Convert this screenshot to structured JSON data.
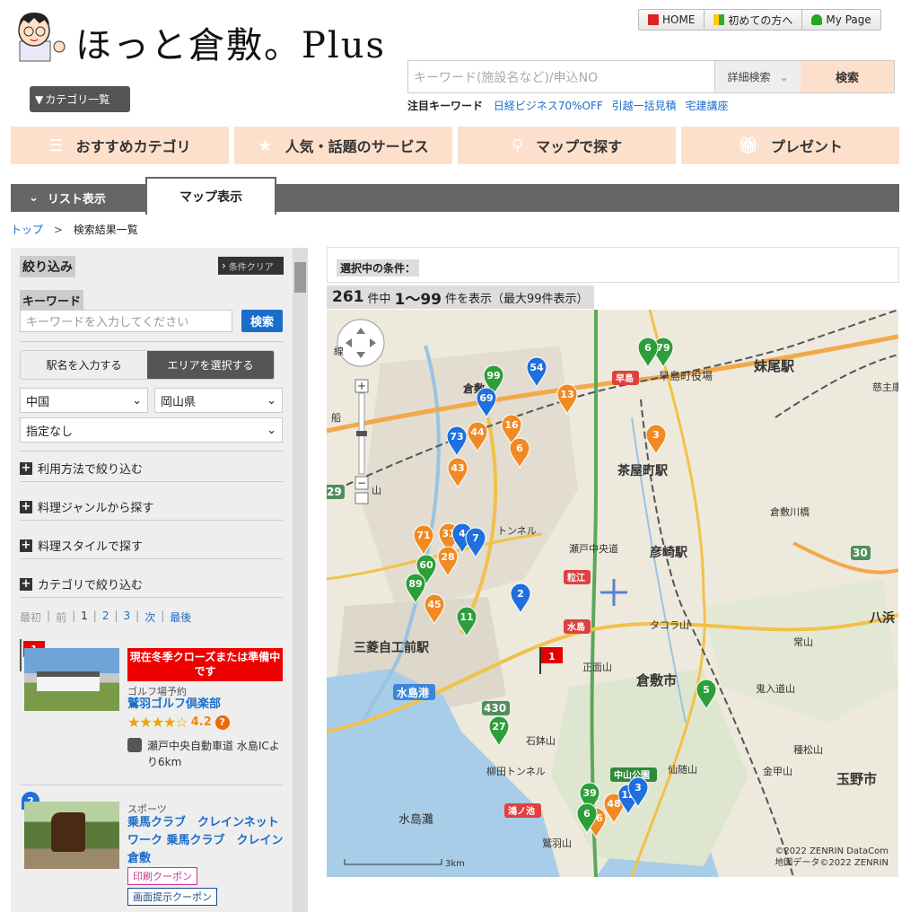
{
  "site": {
    "logo_text": "ほっと倉敷。Plus"
  },
  "topnav": [
    {
      "label": "HOME",
      "icon": "house-icon"
    },
    {
      "label": "初めての方へ",
      "icon": "beginner-mark-icon"
    },
    {
      "label": "My Page",
      "icon": "person-icon"
    }
  ],
  "search": {
    "placeholder": "キーワード(施設名など)/申込NO",
    "advanced_label": "詳細検索",
    "button_label": "検索"
  },
  "keywords": {
    "heading": "注目キーワード",
    "items": [
      "日経ビジネス70%OFF",
      "引越一括見積",
      "宅建講座"
    ]
  },
  "category_button": "カテゴリ一覧",
  "bigmenu": [
    "おすすめカテゴリ",
    "人気・話題のサービス",
    "マップで探す",
    "プレゼント"
  ],
  "tabs": {
    "list": "リスト表示",
    "map": "マップ表示"
  },
  "breadcrumb": {
    "top": "トップ",
    "sep": ">",
    "current": "検索結果一覧"
  },
  "sidebar": {
    "narrow_title": "絞り込み",
    "clear_label": "条件クリア",
    "keyword_label": "キーワード",
    "keyword_placeholder": "キーワードを入力してください",
    "keyword_button": "検索",
    "station_tab": "駅名を入力する",
    "area_tab": "エリアを選択する",
    "region": "中国",
    "prefecture": "岡山県",
    "city": "指定なし",
    "accordions": [
      "利用方法で絞り込む",
      "料理ジャンルから探す",
      "料理スタイルで探す",
      "カテゴリで絞り込む"
    ],
    "pager": {
      "first": "最初",
      "prev": "前",
      "current": "1",
      "pages": [
        "2",
        "3"
      ],
      "next": "次",
      "last": "最後"
    }
  },
  "results": [
    {
      "rank": "1",
      "notice": "現在冬季クローズまたは準備中です",
      "category": "ゴルフ場予約",
      "title": "鷲羽ゴルフ倶楽部",
      "rating": "4.2",
      "help": "?",
      "access": "瀬戸中央自動車道 水島ICより6km"
    },
    {
      "rank": "2",
      "category": "スポーツ",
      "title": "乗馬クラブ　クレインネットワーク 乗馬クラブ　クレイン倉敷",
      "coupons": [
        "印刷クーポン",
        "画面提示クーポン"
      ]
    }
  ],
  "conditions_label": "選択中の条件：",
  "count": {
    "total": "261",
    "unit": "件中",
    "range": "1〜99",
    "suffix": "件を表示（最大99件表示）"
  },
  "map": {
    "labels": [
      "妹尾駅",
      "早島町役場",
      "茶屋町駅",
      "彦崎駅",
      "倉敷市",
      "三菱自工前駅",
      "水島港",
      "玉野市",
      "水島灘",
      "倉敷川橋",
      "常山",
      "鬼入道山",
      "仙随山",
      "金甲山",
      "石鉢山",
      "柳田トンネル",
      "鷲羽山",
      "八浜",
      "早島",
      "粒江",
      "水島",
      "中山公園",
      "鴻ノ池",
      "タコラ山",
      "倉敷",
      "正面山",
      "種松山",
      "瀬戸中央道",
      "トンネル",
      "慈主康",
      "線",
      "船",
      "山"
    ],
    "road_numbers": [
      "30",
      "29",
      "430"
    ],
    "attribution": [
      "©2022 ZENRIN DataCom",
      "地図データ©2022 ZENRIN"
    ],
    "scale": "3km",
    "markers": [
      {
        "n": "79",
        "c": "green"
      },
      {
        "n": "6",
        "c": "green"
      },
      {
        "n": "54",
        "c": "blue"
      },
      {
        "n": "99",
        "c": "green"
      },
      {
        "n": "69",
        "c": "blue"
      },
      {
        "n": "13",
        "c": "orange"
      },
      {
        "n": "16",
        "c": "orange"
      },
      {
        "n": "44",
        "c": "orange"
      },
      {
        "n": "73",
        "c": "blue"
      },
      {
        "n": "6",
        "c": "orange"
      },
      {
        "n": "43",
        "c": "orange"
      },
      {
        "n": "3",
        "c": "orange"
      },
      {
        "n": "71",
        "c": "orange"
      },
      {
        "n": "31",
        "c": "orange"
      },
      {
        "n": "4",
        "c": "blue"
      },
      {
        "n": "7",
        "c": "blue"
      },
      {
        "n": "28",
        "c": "orange"
      },
      {
        "n": "60",
        "c": "green"
      },
      {
        "n": "89",
        "c": "green"
      },
      {
        "n": "45",
        "c": "orange"
      },
      {
        "n": "11",
        "c": "green"
      },
      {
        "n": "2",
        "c": "blue"
      },
      {
        "n": "5",
        "c": "green"
      },
      {
        "n": "27",
        "c": "green"
      },
      {
        "n": "39",
        "c": "green"
      },
      {
        "n": "48",
        "c": "orange"
      },
      {
        "n": "12",
        "c": "blue"
      },
      {
        "n": "3",
        "c": "blue"
      },
      {
        "n": "76",
        "c": "orange"
      },
      {
        "n": "6",
        "c": "green"
      }
    ]
  },
  "colors": {
    "accent_peach": "#fde0cc",
    "link": "#1a6dc9",
    "marker_orange": "#f08a24",
    "marker_blue": "#1f6fe0",
    "marker_green": "#2e9e3a",
    "flag_red": "#e00000"
  }
}
